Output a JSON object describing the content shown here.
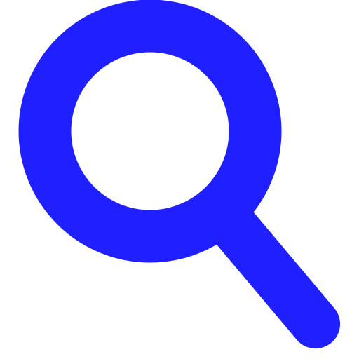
{
  "icon": {
    "name": "search-icon",
    "color": "#1f1fff"
  }
}
